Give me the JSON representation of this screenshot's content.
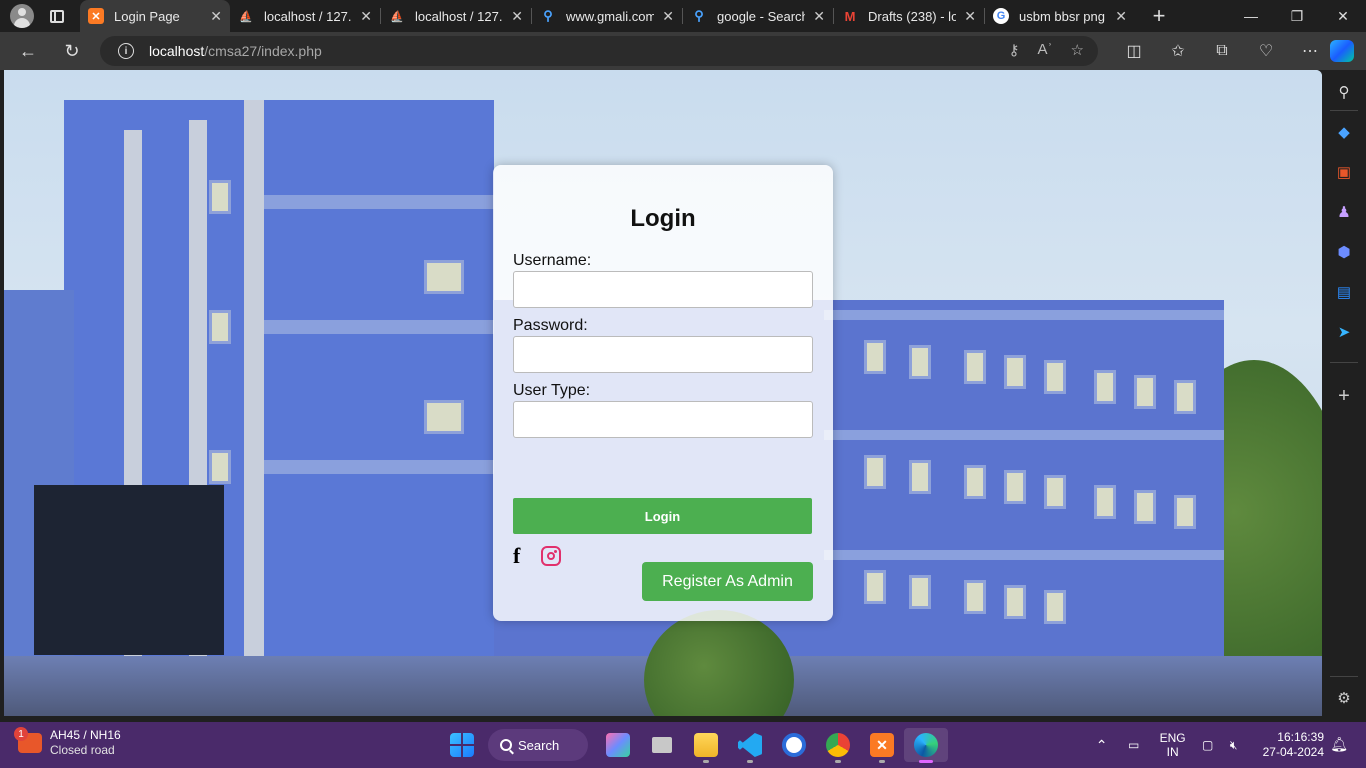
{
  "browser": {
    "tabs": [
      {
        "title": "Login Page",
        "favicon": "xampp-icon",
        "active": true
      },
      {
        "title": "localhost / 127.0",
        "favicon": "phpmyadmin-icon",
        "active": false
      },
      {
        "title": "localhost / 127.0",
        "favicon": "phpmyadmin-icon",
        "active": false
      },
      {
        "title": "www.gmali.com",
        "favicon": "search-icon",
        "active": false
      },
      {
        "title": "google - Search",
        "favicon": "search-icon",
        "active": false
      },
      {
        "title": "Drafts (238) - lo",
        "favicon": "gmail-icon",
        "active": false
      },
      {
        "title": "usbm bbsr png",
        "favicon": "google-icon",
        "active": false
      }
    ],
    "url_host": "localhost",
    "url_path": "/cmsa27/index.php"
  },
  "login": {
    "heading": "Login",
    "username_label": "Username:",
    "username_value": "",
    "password_label": "Password:",
    "password_value": "",
    "usertype_label": "User Type:",
    "usertype_value": "",
    "login_button": "Login",
    "register_button": "Register As Admin"
  },
  "taskbar": {
    "weather_title": "AH45 / NH16",
    "weather_sub": "Closed road",
    "weather_badge": "1",
    "search_label": "Search",
    "lang_top": "ENG",
    "lang_bottom": "IN",
    "time": "16:16:39",
    "date": "27-04-2024"
  },
  "colors": {
    "accent_green": "#4caf50",
    "taskbar": "#4a2a6a",
    "browser_chrome": "#3a3a3a"
  }
}
